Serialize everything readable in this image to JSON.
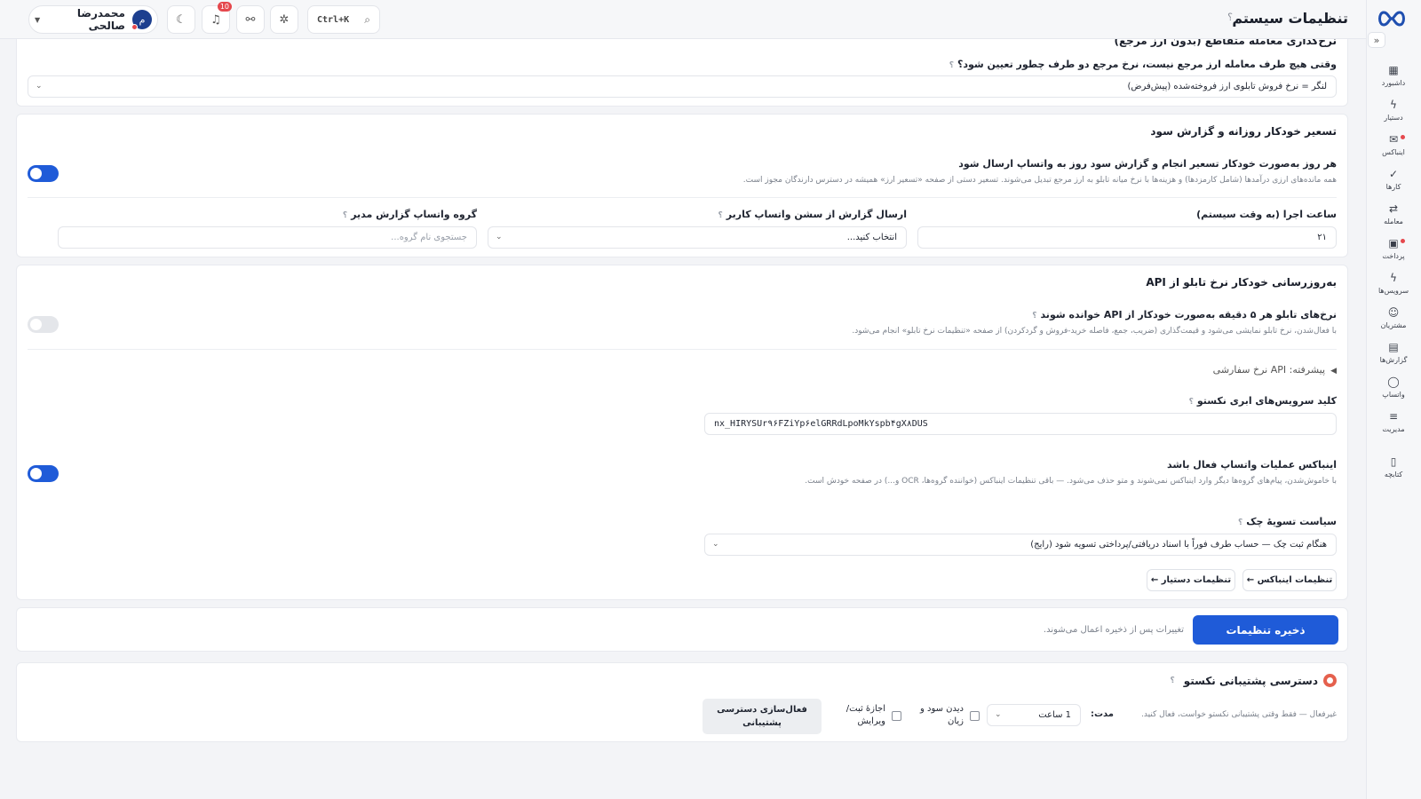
{
  "app": {
    "title": "تنظیمات سیستم",
    "help": "؟"
  },
  "header": {
    "user_name": "محمدرضا صالحی",
    "avatar_initial": "م",
    "notification_count": "10",
    "search_shortcut": "Ctrl+K"
  },
  "sidebar": {
    "collapse": "«",
    "items": [
      {
        "label": "داشبورد",
        "icon": "dashboard-icon"
      },
      {
        "label": "دستیار",
        "icon": "bolt-icon"
      },
      {
        "label": "اینباکس",
        "icon": "inbox-icon"
      },
      {
        "label": "کارها",
        "icon": "check-icon"
      },
      {
        "label": "معامله",
        "icon": "swap-icon"
      },
      {
        "label": "پرداخت",
        "icon": "wallet-icon"
      },
      {
        "label": "سرویس‌ها",
        "icon": "bolt-icon"
      },
      {
        "label": "مشتریان",
        "icon": "users-icon"
      },
      {
        "label": "گزارش‌ها",
        "icon": "report-icon"
      },
      {
        "label": "واتساپ",
        "icon": "chat-icon"
      },
      {
        "label": "مدیریت",
        "icon": "sliders-icon"
      },
      {
        "label": "کتابچه",
        "icon": "book-icon"
      }
    ]
  },
  "cross_rate": {
    "title": "نرخ‌گذاری معامله متقاطع (بدون ارز مرجع)",
    "question": "وقتی هیچ طرف معامله ارز مرجع نیست، نرخ مرجع دو طرف چطور تعیین شود؟",
    "value": "لنگر = نرخ فروش تابلوی ارز فروخته‌شده (پیش‌فرض)"
  },
  "daily_revaluation": {
    "title": "تسعیر خودکار روزانه و گزارش سود",
    "toggle_label": "هر روز به‌صورت خودکار تسعیر انجام و گزارش سود روز به واتساپ ارسال شود",
    "toggle_hint": "همه مانده‌های ارزی درآمدها (شامل کارمزدها) و هزینه‌ها با نرخ میانه تابلو به ارز مرجع تبدیل می‌شوند. تسعیر دستی از صفحه «تسعیر ارز» همیشه در دسترس دارندگان مجوز است.",
    "enabled": true,
    "run_time_label": "ساعت اجرا (به وقت سیستم)",
    "run_time_value": "۲۱",
    "session_label": "ارسال گزارش از سشن واتساپ کاربر",
    "session_value": "انتخاب کنید...",
    "group_label": "گروه واتساپ گزارش مدیر",
    "group_placeholder": "جستجوی نام گروه..."
  },
  "api_rates": {
    "title": "به‌روزرسانی خودکار نرخ تابلو از API",
    "toggle_label": "نرخ‌های تابلو هر ۵ دقیقه به‌صورت خودکار از API خوانده شوند",
    "toggle_hint": "با فعال‌شدن، نرخ تابلو نمایشی می‌شود و قیمت‌گذاری (ضریب، جمع، فاصله خرید-فروش و گردکردن) از صفحه «تنظیمات نرخ تابلو» انجام می‌شود.",
    "enabled": false,
    "advanced": "پیشرفته: API نرخ سفارشی",
    "key_label": "کلید سرویس‌های ابری نکستو",
    "key_value": "nx_HIRYSUr۹۶FZiYp۶elGRRdLpoMkYspb۴gX۸DUS",
    "inbox_label": "اینباکس عملیات واتساپ فعال باشد",
    "inbox_hint": "با خاموش‌شدن، پیام‌های گروه‌ها دیگر وارد اینباکس نمی‌شوند و متو حذف می‌شود. — باقی تنظیمات اینباکس (خواننده گروه‌ها، OCR و...) در صفحه خودش است.",
    "inbox_enabled": true,
    "cheque_label": "سیاست تسویهٔ چک",
    "cheque_value": "هنگام ثبت چک — حساب طرف فوراً با اسناد دریافتی/پرداختی تسویه شود (رایج)",
    "inbox_settings_btn": "تنظیمات اینباکس ←",
    "assistant_settings_btn": "تنظیمات دستیار ←"
  },
  "save": {
    "button": "ذخیره تنظیمات",
    "note": "تغییرات پس از ذخیره اعمال می‌شوند."
  },
  "support": {
    "title": "دسترسی پشتیبانی نکستو",
    "status": "غیرفعال — فقط وقتی پشتیبانی نکستو خواست، فعال کنید.",
    "duration_label": "مدت:",
    "duration_value": "1 ساعت",
    "profit_label_1": "دیدن سود و",
    "profit_label_2": "زیان",
    "edit_label_1": "اجازهٔ ثبت/",
    "edit_label_2": "ویرایش",
    "activate_1": "فعال‌سازی دسترسی",
    "activate_2": "پشتیبانی"
  },
  "colors": {
    "primary": "#1f5bd8",
    "danger": "#e5484d",
    "background": "#f3f4f7"
  }
}
